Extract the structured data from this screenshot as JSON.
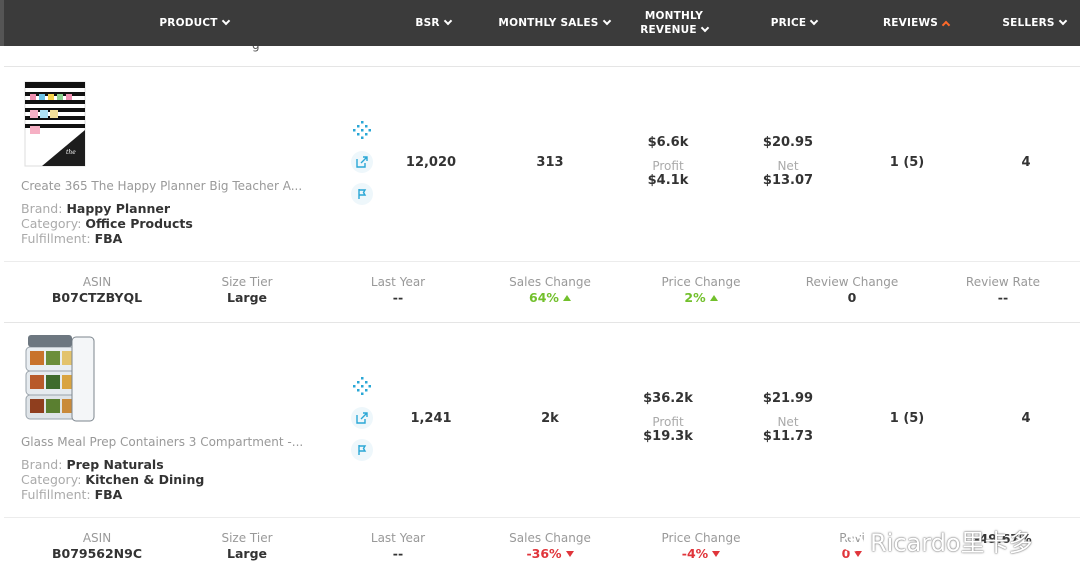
{
  "header": {
    "columns": [
      {
        "label": "Product"
      },
      {
        "label": "BSR"
      },
      {
        "label": "Monthly Sales"
      },
      {
        "label_line1": "Monthly",
        "label_line2": "Revenue"
      },
      {
        "label": "Price"
      },
      {
        "label": "Reviews"
      },
      {
        "label": "Sellers"
      }
    ]
  },
  "prev_peek": "g",
  "products": [
    {
      "title": "Create 365 The Happy Planner Big Teacher A...",
      "brand_label": "Brand:",
      "brand": "Happy Planner",
      "category_label": "Category:",
      "category": "Office Products",
      "fulfillment_label": "Fulfillment:",
      "fulfillment": "FBA",
      "bsr": "12,020",
      "monthly_sales": "313",
      "revenue": "$6.6k",
      "profit_label": "Profit",
      "profit": "$4.1k",
      "price": "$20.95",
      "net_label": "Net",
      "net": "$13.07",
      "reviews": "1 (5)",
      "sellers": "4",
      "details": {
        "asin_label": "ASIN",
        "asin": "B07CTZBYQL",
        "size_tier_label": "Size Tier",
        "size_tier": "Large",
        "last_year_label": "Last Year",
        "last_year": "--",
        "sales_change_label": "Sales Change",
        "sales_change": "64%",
        "price_change_label": "Price Change",
        "price_change": "2%",
        "review_change_label": "Review Change",
        "review_change": "0",
        "review_rate_label": "Review Rate",
        "review_rate": "--"
      }
    },
    {
      "title": "Glass Meal Prep Containers 3 Compartment -...",
      "brand_label": "Brand:",
      "brand": "Prep Naturals",
      "category_label": "Category:",
      "category": "Kitchen & Dining",
      "fulfillment_label": "Fulfillment:",
      "fulfillment": "FBA",
      "bsr": "1,241",
      "monthly_sales": "2k",
      "revenue": "$36.2k",
      "profit_label": "Profit",
      "profit": "$19.3k",
      "price": "$21.99",
      "net_label": "Net",
      "net": "$11.73",
      "reviews": "1 (5)",
      "sellers": "4",
      "details": {
        "asin_label": "ASIN",
        "asin": "B079562N9C",
        "size_tier_label": "Size Tier",
        "size_tier": "Large",
        "last_year_label": "Last Year",
        "last_year": "--",
        "sales_change_label": "Sales Change",
        "sales_change": "-36%",
        "price_change_label": "Price Change",
        "price_change": "-4%",
        "review_change_label": "Revi",
        "review_change": "0",
        "review_rate_label": "",
        "review_rate": "-49.67%"
      }
    }
  ],
  "watermark": "Ricardo里卡多",
  "colors": {
    "header_bg": "#3b3b3b",
    "sort_active": "#ff6a2a",
    "positive": "#72c02c",
    "negative": "#e0353b",
    "icon_teal": "#2aa7d6"
  }
}
